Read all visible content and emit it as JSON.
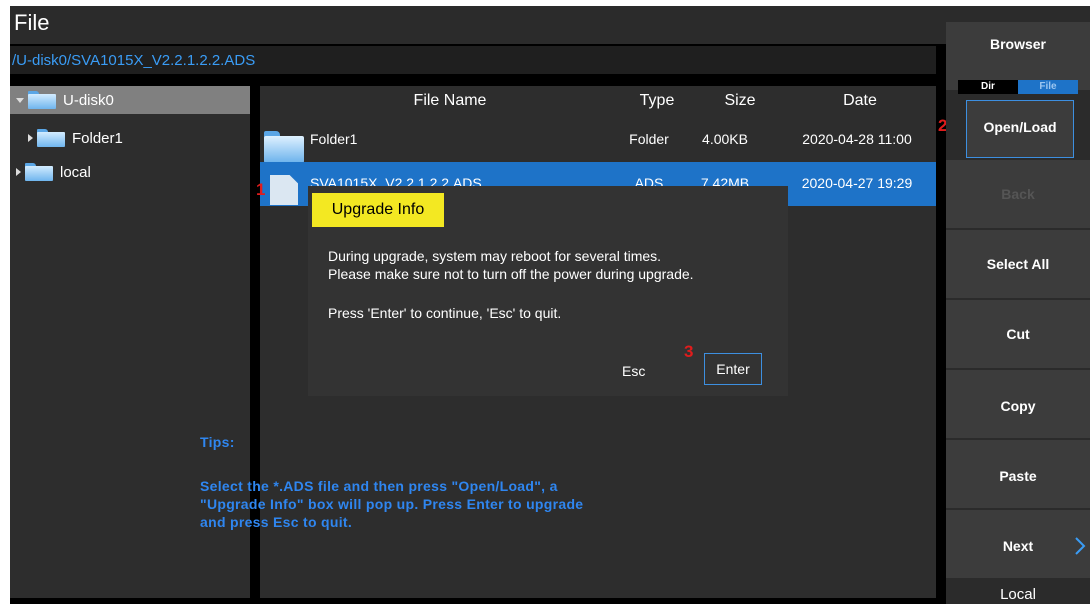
{
  "window": {
    "title": "File",
    "path": "/U-disk0/SVA1015X_V2.2.1.2.2.ADS"
  },
  "tree": {
    "items": [
      {
        "label": "U-disk0"
      },
      {
        "label": "Folder1"
      },
      {
        "label": "local"
      }
    ]
  },
  "table": {
    "headers": {
      "name": "File Name",
      "type": "Type",
      "size": "Size",
      "date": "Date"
    },
    "rows": [
      {
        "name": "Folder1",
        "type": "Folder",
        "size": "4.00KB",
        "date": "2020-04-28 11:00"
      },
      {
        "name": "SVA1015X_V2.2.1.2.2.ADS",
        "type": "ADS",
        "size": "7.42MB",
        "date": "2020-04-27 19:29"
      }
    ]
  },
  "dialog": {
    "title": "Upgrade Info",
    "line1": "During upgrade, system may reboot for several times.",
    "line2": "Please make sure not to turn off the power during upgrade.",
    "line3": "Press 'Enter' to continue, 'Esc' to quit.",
    "esc_label": "Esc",
    "enter_label": "Enter"
  },
  "markers": {
    "m1": "1",
    "m2": "2",
    "m3": "3"
  },
  "tips": {
    "heading": "Tips:",
    "line1": "Select the *.ADS file and then press \"Open/Load\", a",
    "line2": "\"Upgrade Info\" box will pop up. Press Enter to upgrade",
    "line3": "and press Esc to quit."
  },
  "sidebar": {
    "header": "Browser",
    "toggle_dir": "Dir",
    "toggle_file": "File",
    "buttons": {
      "open_load": "Open/Load",
      "back": "Back",
      "select_all": "Select All",
      "cut": "Cut",
      "copy": "Copy",
      "paste": "Paste",
      "next": "Next",
      "local": "Local"
    }
  },
  "colors": {
    "accent": "#1e73c8",
    "tips": "#2f86f0",
    "highlight": "#f3e822",
    "marker": "#e11c1c"
  }
}
